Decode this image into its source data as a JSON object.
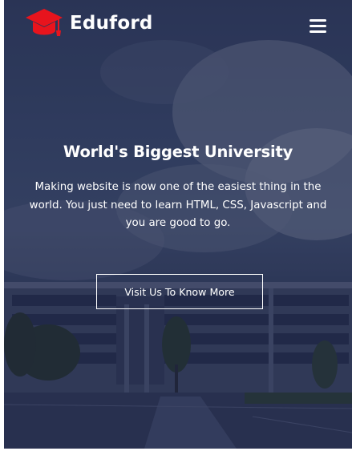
{
  "header": {
    "brand": "Eduford",
    "logo_icon": "graduation-cap-icon",
    "menu_icon": "hamburger-menu-icon"
  },
  "hero": {
    "title": "World's Biggest University",
    "subtitle": "Making website is now one of the easiest thing in the world. You just need to learn HTML, CSS, Javascript and you are good to go.",
    "cta_label": "Visit Us To Know More"
  },
  "colors": {
    "brand_red": "#e8141d",
    "text": "#ffffff",
    "overlay": "#141a3c"
  }
}
